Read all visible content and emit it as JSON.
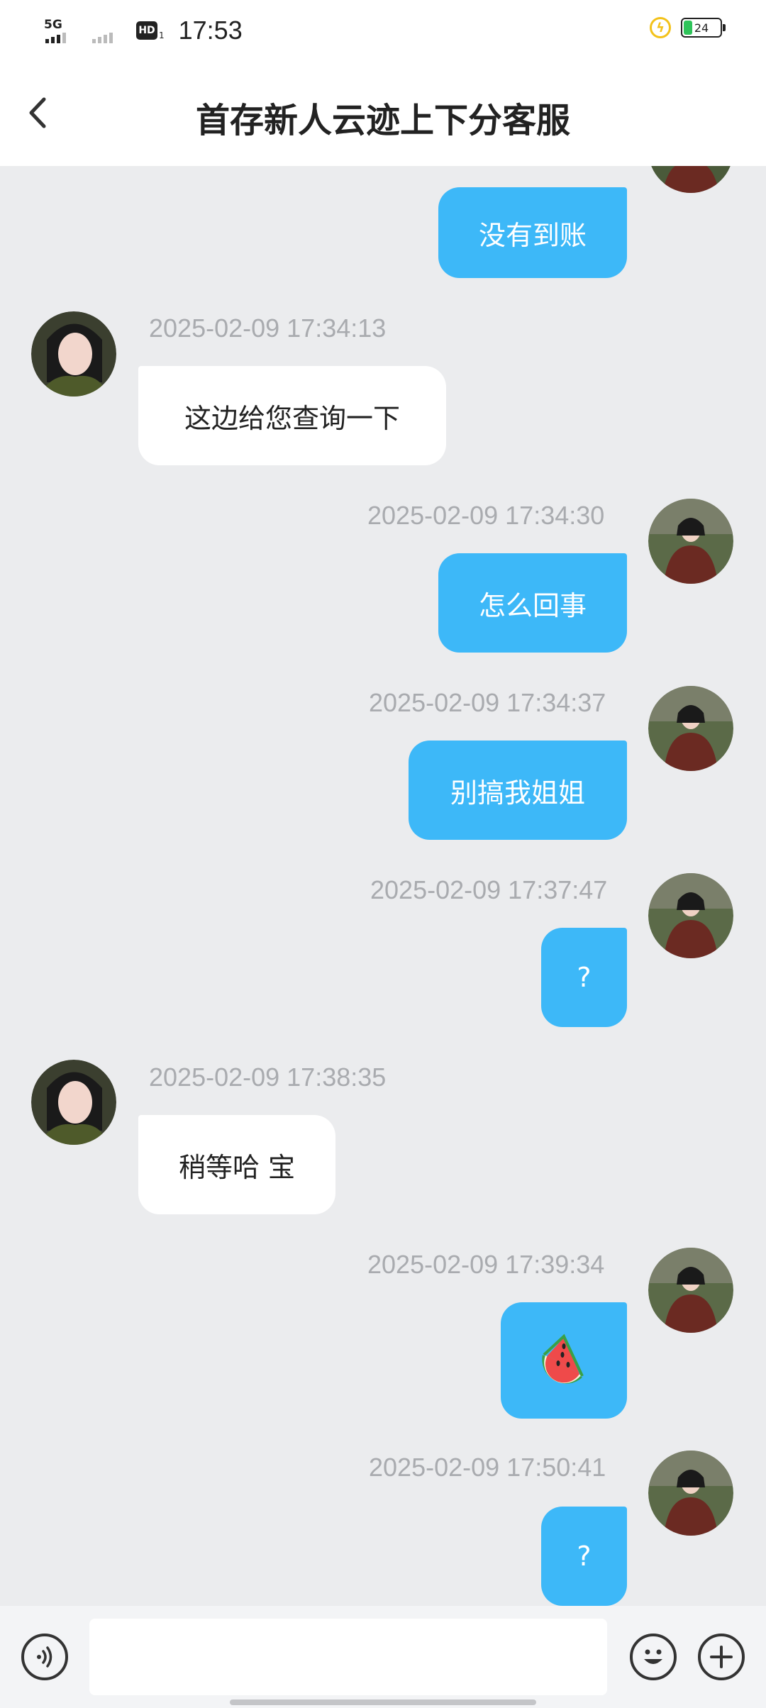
{
  "status_bar": {
    "network": "5G",
    "hd_label": "HD",
    "hd_sub": "1",
    "time": "17:53",
    "battery_level": "24",
    "battery_fraction": 0.24
  },
  "header": {
    "title": "首存新人云迹上下分客服",
    "back_icon": "chevron-left-icon"
  },
  "messages": [
    {
      "sender": "me",
      "text": "没有到账"
    },
    {
      "sender": "agent",
      "time": "2025-02-09 17:34:13",
      "text": "这边给您查询一下"
    },
    {
      "sender": "me",
      "time": "2025-02-09 17:34:30",
      "text": "怎么回事"
    },
    {
      "sender": "me",
      "time": "2025-02-09 17:34:37",
      "text": "别搞我姐姐"
    },
    {
      "sender": "me",
      "time": "2025-02-09 17:37:47",
      "text": "?"
    },
    {
      "sender": "agent",
      "time": "2025-02-09 17:38:35",
      "text": "稍等哈 宝"
    },
    {
      "sender": "me",
      "time": "2025-02-09 17:39:34",
      "text": "🍉",
      "icon": "watermelon-emoji-icon"
    },
    {
      "sender": "me",
      "time": "2025-02-09 17:50:41",
      "text": "?"
    }
  ],
  "input_bar": {
    "voice_icon": "voice-icon",
    "emoji_icon": "smile-icon",
    "plus_icon": "plus-icon",
    "placeholder": ""
  },
  "colors": {
    "my_bubble": "#3db8f8",
    "their_bubble": "#ffffff",
    "chat_background": "#ebecee",
    "timestamp": "#a9abaf"
  }
}
